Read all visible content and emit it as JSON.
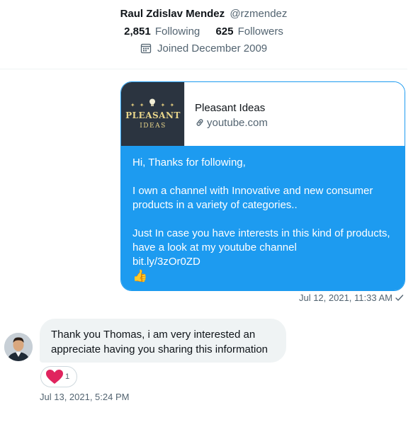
{
  "profile": {
    "name": "Raul Zdislav Mendez",
    "handle": "@rzmendez",
    "following_count": "2,851",
    "following_label": "Following",
    "followers_count": "625",
    "followers_label": "Followers",
    "joined": "Joined December 2009"
  },
  "link_card": {
    "title": "Pleasant Ideas",
    "domain": "youtube.com",
    "thumbnail_line1": "PLEASANT",
    "thumbnail_line2": "IDEAS"
  },
  "sent_message": {
    "line1": "Hi, Thanks for following,",
    "line2": "I own a channel with Innovative and new consumer products in a variety of categories..",
    "line3": "Just In case you have interests in this kind of products, have a look at my youtube channel",
    "link": "bit.ly/3zOr0ZD",
    "emoji": "👍",
    "timestamp": "Jul 12, 2021, 11:33 AM"
  },
  "received_message": {
    "text": "Thank you Thomas, i am very interested an appreciate having you sharing this information",
    "reaction_count": "1",
    "timestamp": "Jul 13, 2021, 5:24 PM"
  },
  "colors": {
    "accent": "#1d9bf0",
    "muted": "#536471",
    "bubble_gray": "#eff3f4",
    "heart": "#f91880"
  },
  "icons": {
    "joined": "calendar-icon",
    "domain": "link-icon",
    "status": "checkmark-icon",
    "reaction": "heart-icon"
  }
}
